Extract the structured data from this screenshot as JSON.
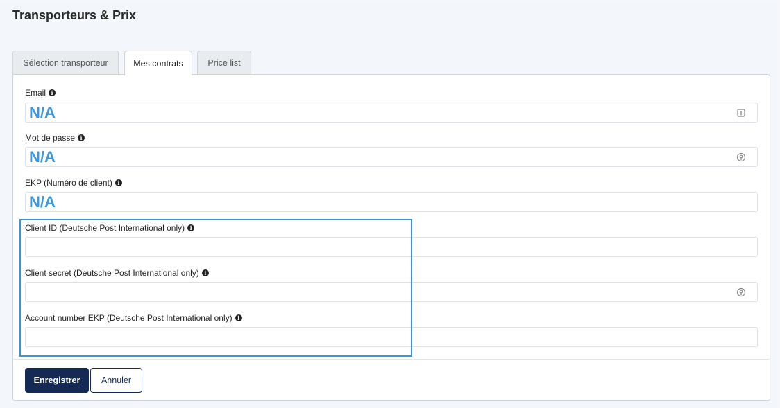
{
  "page": {
    "title": "Transporteurs & Prix"
  },
  "tabs": [
    {
      "label": "Sélection transporteur"
    },
    {
      "label": "Mes contrats"
    },
    {
      "label": "Price list"
    }
  ],
  "fields": {
    "email": {
      "label": "Email",
      "value": "N/A"
    },
    "password": {
      "label": "Mot de passe",
      "value": "N/A"
    },
    "ekp": {
      "label": "EKP (Numéro de client)",
      "value": "N/A"
    },
    "client_id": {
      "label": "Client ID (Deutsche Post International only)",
      "value": ""
    },
    "client_secret": {
      "label": "Client secret (Deutsche Post International only)",
      "value": ""
    },
    "account_number": {
      "label": "Account number EKP (Deutsche Post International only)",
      "value": ""
    }
  },
  "actions": {
    "save_label": "Enregistrer",
    "cancel_label": "Annuler"
  },
  "colors": {
    "primary": "#142a55",
    "highlight": "#3a97d6",
    "value_text": "#3a97e0"
  },
  "icons": {
    "info": "info-circle-icon",
    "email_field": "exclamation-box-icon",
    "password_field": "key-circle-icon"
  }
}
